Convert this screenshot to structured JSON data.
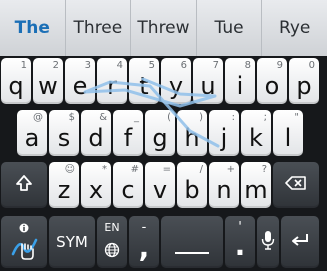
{
  "suggestions": [
    "The",
    "Three",
    "Threw",
    "Tue",
    "Rye"
  ],
  "keys": {
    "row1": [
      {
        "label": "q",
        "hint": "1"
      },
      {
        "label": "w",
        "hint": "2"
      },
      {
        "label": "e",
        "hint": "3"
      },
      {
        "label": "r",
        "hint": "4"
      },
      {
        "label": "t",
        "hint": "5"
      },
      {
        "label": "y",
        "hint": "6"
      },
      {
        "label": "u",
        "hint": "7"
      },
      {
        "label": "i",
        "hint": "8"
      },
      {
        "label": "o",
        "hint": "9"
      },
      {
        "label": "p",
        "hint": "0"
      }
    ],
    "row2": [
      {
        "label": "a",
        "hint": "@"
      },
      {
        "label": "s",
        "hint": "$"
      },
      {
        "label": "d",
        "hint": "&"
      },
      {
        "label": "f",
        "hint": "_"
      },
      {
        "label": "g",
        "hint": "("
      },
      {
        "label": "h",
        "hint": ")"
      },
      {
        "label": "j",
        "hint": ":"
      },
      {
        "label": "k",
        "hint": ";"
      },
      {
        "label": "l",
        "hint": "\""
      }
    ],
    "row3": [
      {
        "label": "z",
        "hint": "☺"
      },
      {
        "label": "x",
        "hint": "*"
      },
      {
        "label": "c",
        "hint": "#"
      },
      {
        "label": "v",
        "hint": "="
      },
      {
        "label": "b",
        "hint": "/"
      },
      {
        "label": "n",
        "hint": "+"
      },
      {
        "label": "m",
        "hint": "?"
      }
    ],
    "sym_label": "SYM",
    "lang_label": "EN",
    "comma": ",",
    "comma_hint": "-",
    "period": ".",
    "period_hint": "'",
    "shift_icon": "shift-icon",
    "delete_icon": "delete-icon"
  },
  "colors": {
    "primary_suggestion": "#1b6fb6",
    "trace": "#7fb6e6"
  }
}
